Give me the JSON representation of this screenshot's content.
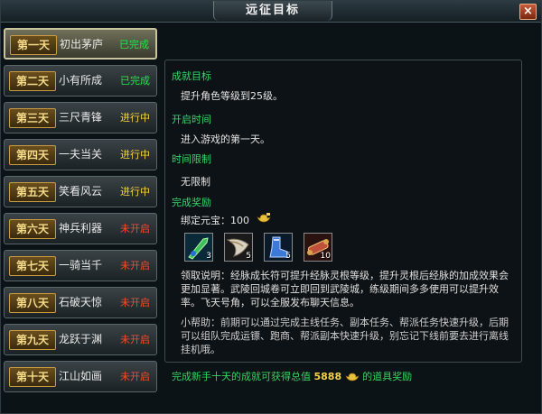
{
  "window": {
    "title": "远征目标",
    "close_label": "×"
  },
  "days": [
    {
      "tag": "第一天",
      "name": "初出茅庐",
      "status": "已完成",
      "state": "done"
    },
    {
      "tag": "第二天",
      "name": "小有所成",
      "status": "已完成",
      "state": "done"
    },
    {
      "tag": "第三天",
      "name": "三尺青锋",
      "status": "进行中",
      "state": "prog"
    },
    {
      "tag": "第四天",
      "name": "一夫当关",
      "status": "进行中",
      "state": "prog"
    },
    {
      "tag": "第五天",
      "name": "笑看风云",
      "status": "进行中",
      "state": "prog"
    },
    {
      "tag": "第六天",
      "name": "神兵利器",
      "status": "未开启",
      "state": "lock"
    },
    {
      "tag": "第七天",
      "name": "一骑当千",
      "status": "未开启",
      "state": "lock"
    },
    {
      "tag": "第八天",
      "name": "石破天惊",
      "status": "未开启",
      "state": "lock"
    },
    {
      "tag": "第九天",
      "name": "龙跃于渊",
      "status": "未开启",
      "state": "lock"
    },
    {
      "tag": "第十天",
      "name": "江山如画",
      "status": "未开启",
      "state": "lock"
    }
  ],
  "selected_day": 0,
  "detail": {
    "goal_heading": "成就目标",
    "goal_text": "提升角色等级到25级。",
    "open_heading": "开启时间",
    "open_text": "进入游戏的第一天。",
    "limit_heading": "时间限制",
    "limit_text": "无限制",
    "reward_heading": "完成奖励",
    "bound_gold_label": "绑定元宝：",
    "bound_gold_value": "100",
    "items": [
      {
        "icon": "green-blade-icon",
        "count": "3"
      },
      {
        "icon": "horn-icon",
        "count": "5"
      },
      {
        "icon": "blue-boot-icon",
        "count": "5"
      },
      {
        "icon": "scroll-icon",
        "count": "10"
      }
    ],
    "claim_note": "领取说明：经脉成长符可提升经脉灵根等级，提升灵根后经脉的加成效果会更加显著。武陵回城卷可立即回到武陵城，练级期间多多使用可以提升效率。飞天号角，可以全服发布聊天信息。",
    "help_note": "小帮助：前期可以通过完成主线任务、副本任务、帮派任务快速升级，后期可以组队完成运镖、跑商、帮派副本快速升级，别忘记下线前要去进行离线挂机哦。"
  },
  "footer": {
    "prefix": "完成新手十天的成就可获得总值",
    "value": "5888",
    "suffix": "的道具奖励"
  },
  "colors": {
    "done": "#23e34a",
    "in_progress": "#f5d63a",
    "locked": "#f24b2e",
    "heading_green": "#37d66d"
  }
}
